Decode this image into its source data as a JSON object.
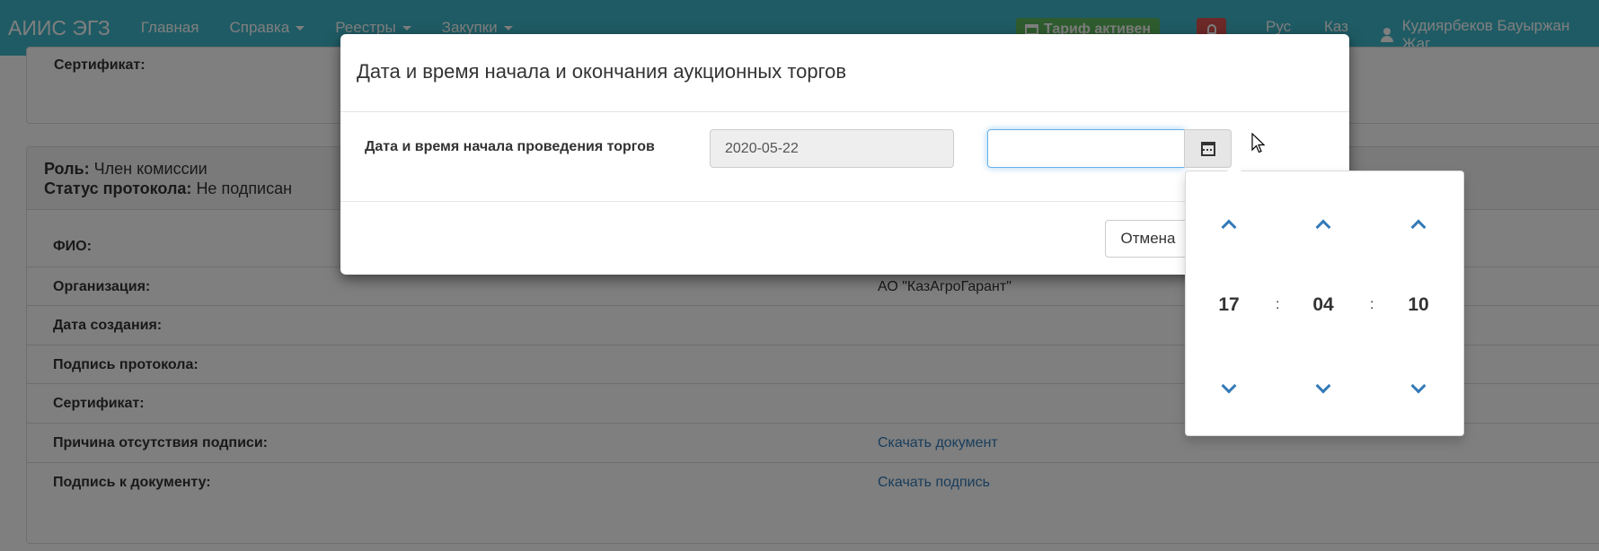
{
  "navbar": {
    "brand": "АИИС ЭГЗ",
    "items": [
      "Главная",
      "Справка",
      "Реестры",
      "Закупки"
    ],
    "tariff": "Тариф активен",
    "lang_ru": "Рус",
    "lang_kz": "Каз",
    "user": "Кудиярбеков Бауыржан Жаг"
  },
  "page": {
    "top_row_label": "Сертификат:",
    "role_label": "Роль:",
    "role_value": "Член комиссии",
    "status_label": "Статус протокола:",
    "status_value": "Не подписан",
    "rows": [
      {
        "label": "ФИО:",
        "value": ""
      },
      {
        "label": "Организация:",
        "value": "АО \"КазАгроГарант\""
      },
      {
        "label": "Дата создания:",
        "value": ""
      },
      {
        "label": "Подпись протокола:",
        "value": ""
      },
      {
        "label": "Сертификат:",
        "value": ""
      },
      {
        "label": "Причина отсутствия подписи:",
        "value": "Скачать документ"
      },
      {
        "label": "Подпись к документу:",
        "value": "Скачать подпись"
      }
    ]
  },
  "modal": {
    "title": "Дата и время начала и окончания аукционных торгов",
    "field_label": "Дата и время начала проведения торгов",
    "date_value": "2020-05-22",
    "time_value": "",
    "cancel_label": "Отмена"
  },
  "timepicker": {
    "hours": "17",
    "minutes": "04",
    "seconds": "10",
    "separator": ":"
  },
  "colors": {
    "navbar": "#3fb6c9",
    "link": "#337ab7",
    "tariff": "#5cb85c",
    "bell": "#d9534f"
  }
}
